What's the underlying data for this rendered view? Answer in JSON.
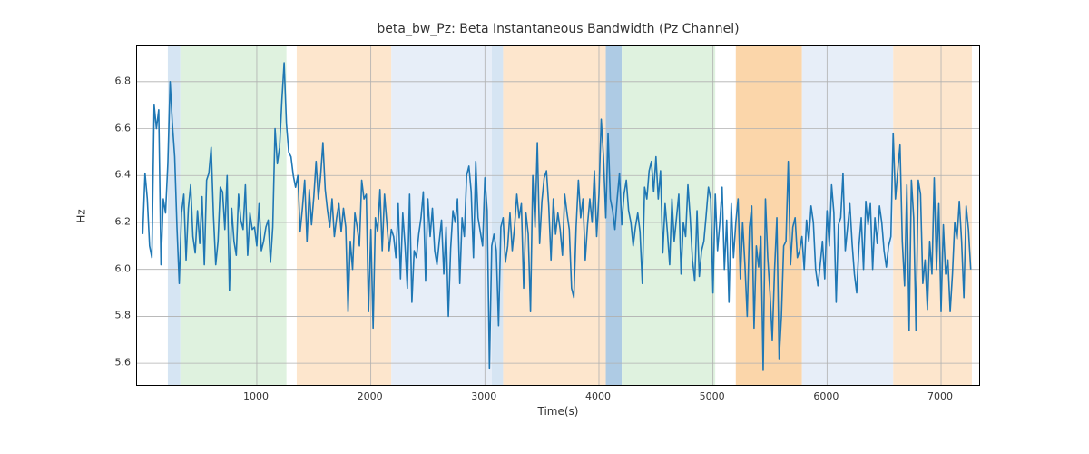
{
  "chart_data": {
    "type": "line",
    "title": "beta_bw_Pz: Beta Instantaneous Bandwidth (Pz Channel)",
    "xlabel": "Time(s)",
    "ylabel": "Hz",
    "xlim": [
      -50,
      7350
    ],
    "ylim": [
      5.5,
      6.95
    ],
    "xticks": [
      1000,
      2000,
      3000,
      4000,
      5000,
      6000,
      7000
    ],
    "yticks": [
      5.6,
      5.8,
      6.0,
      6.2,
      6.4,
      6.6,
      6.8
    ],
    "bands": [
      {
        "x0": 220,
        "x1": 330,
        "color": "#d6e5f3"
      },
      {
        "x0": 330,
        "x1": 1260,
        "color": "#dff2df"
      },
      {
        "x0": 1350,
        "x1": 2180,
        "color": "#fde6cd"
      },
      {
        "x0": 2180,
        "x1": 3060,
        "color": "#e7eef8"
      },
      {
        "x0": 3060,
        "x1": 3160,
        "color": "#d6e5f3"
      },
      {
        "x0": 3160,
        "x1": 4060,
        "color": "#fde6cd"
      },
      {
        "x0": 4060,
        "x1": 4200,
        "color": "#aecbe4"
      },
      {
        "x0": 4200,
        "x1": 5020,
        "color": "#dff2df"
      },
      {
        "x0": 5200,
        "x1": 5780,
        "color": "#fbd6aa"
      },
      {
        "x0": 5780,
        "x1": 6580,
        "color": "#e7eef8"
      },
      {
        "x0": 6580,
        "x1": 7270,
        "color": "#fde6cd"
      }
    ],
    "x": [
      0,
      20,
      40,
      60,
      80,
      100,
      120,
      140,
      160,
      180,
      200,
      220,
      240,
      260,
      280,
      300,
      320,
      340,
      360,
      380,
      400,
      420,
      440,
      460,
      480,
      500,
      520,
      540,
      560,
      580,
      600,
      620,
      640,
      660,
      680,
      700,
      720,
      740,
      760,
      780,
      800,
      820,
      840,
      860,
      880,
      900,
      920,
      940,
      960,
      980,
      1000,
      1020,
      1040,
      1060,
      1080,
      1100,
      1120,
      1140,
      1160,
      1180,
      1200,
      1220,
      1240,
      1260,
      1280,
      1300,
      1320,
      1340,
      1360,
      1380,
      1400,
      1420,
      1440,
      1460,
      1480,
      1500,
      1520,
      1540,
      1560,
      1580,
      1600,
      1620,
      1640,
      1660,
      1680,
      1700,
      1720,
      1740,
      1760,
      1780,
      1800,
      1820,
      1840,
      1860,
      1880,
      1900,
      1920,
      1940,
      1960,
      1980,
      2000,
      2020,
      2040,
      2060,
      2080,
      2100,
      2120,
      2140,
      2160,
      2180,
      2200,
      2220,
      2240,
      2260,
      2280,
      2300,
      2320,
      2340,
      2360,
      2380,
      2400,
      2420,
      2440,
      2460,
      2480,
      2500,
      2520,
      2540,
      2560,
      2580,
      2600,
      2620,
      2640,
      2660,
      2680,
      2700,
      2720,
      2740,
      2760,
      2780,
      2800,
      2820,
      2840,
      2860,
      2880,
      2900,
      2920,
      2940,
      2960,
      2980,
      3000,
      3020,
      3040,
      3060,
      3080,
      3100,
      3120,
      3140,
      3160,
      3180,
      3200,
      3220,
      3240,
      3260,
      3280,
      3300,
      3320,
      3340,
      3360,
      3380,
      3400,
      3420,
      3440,
      3460,
      3480,
      3500,
      3520,
      3540,
      3560,
      3580,
      3600,
      3620,
      3640,
      3660,
      3680,
      3700,
      3720,
      3740,
      3760,
      3780,
      3800,
      3820,
      3840,
      3860,
      3880,
      3900,
      3920,
      3940,
      3960,
      3980,
      4000,
      4020,
      4040,
      4060,
      4080,
      4100,
      4120,
      4140,
      4160,
      4180,
      4200,
      4220,
      4240,
      4260,
      4280,
      4300,
      4320,
      4340,
      4360,
      4380,
      4400,
      4420,
      4440,
      4460,
      4480,
      4500,
      4520,
      4540,
      4560,
      4580,
      4600,
      4620,
      4640,
      4660,
      4680,
      4700,
      4720,
      4740,
      4760,
      4780,
      4800,
      4820,
      4840,
      4860,
      4880,
      4900,
      4920,
      4940,
      4960,
      4980,
      5000,
      5020,
      5040,
      5060,
      5080,
      5100,
      5120,
      5140,
      5160,
      5180,
      5200,
      5220,
      5240,
      5260,
      5280,
      5300,
      5320,
      5340,
      5360,
      5380,
      5400,
      5420,
      5440,
      5460,
      5480,
      5500,
      5520,
      5540,
      5560,
      5580,
      5600,
      5620,
      5640,
      5660,
      5680,
      5700,
      5720,
      5740,
      5760,
      5780,
      5800,
      5820,
      5840,
      5860,
      5880,
      5900,
      5920,
      5940,
      5960,
      5980,
      6000,
      6020,
      6040,
      6060,
      6080,
      6100,
      6120,
      6140,
      6160,
      6180,
      6200,
      6220,
      6240,
      6260,
      6280,
      6300,
      6320,
      6340,
      6360,
      6380,
      6400,
      6420,
      6440,
      6460,
      6480,
      6500,
      6520,
      6540,
      6560,
      6580,
      6600,
      6620,
      6640,
      6660,
      6680,
      6700,
      6720,
      6740,
      6760,
      6780,
      6800,
      6820,
      6840,
      6860,
      6880,
      6900,
      6920,
      6940,
      6960,
      6980,
      7000,
      7020,
      7040,
      7060,
      7080,
      7100,
      7120,
      7140,
      7160,
      7180,
      7200,
      7220,
      7240,
      7260
    ],
    "y": [
      6.15,
      6.41,
      6.3,
      6.1,
      6.05,
      6.7,
      6.6,
      6.68,
      6.02,
      6.3,
      6.24,
      6.45,
      6.8,
      6.62,
      6.48,
      6.18,
      5.94,
      6.24,
      6.32,
      6.04,
      6.26,
      6.36,
      6.14,
      6.07,
      6.25,
      6.11,
      6.31,
      6.02,
      6.38,
      6.41,
      6.52,
      6.23,
      6.02,
      6.12,
      6.35,
      6.33,
      6.17,
      6.4,
      5.91,
      6.26,
      6.12,
      6.06,
      6.32,
      6.21,
      6.17,
      6.36,
      6.06,
      6.24,
      6.17,
      6.18,
      6.1,
      6.28,
      6.08,
      6.12,
      6.18,
      6.21,
      6.03,
      6.18,
      6.6,
      6.45,
      6.52,
      6.72,
      6.88,
      6.62,
      6.5,
      6.48,
      6.4,
      6.35,
      6.4,
      6.16,
      6.26,
      6.38,
      6.12,
      6.34,
      6.19,
      6.31,
      6.46,
      6.3,
      6.4,
      6.54,
      6.34,
      6.25,
      6.18,
      6.3,
      6.14,
      6.22,
      6.28,
      6.16,
      6.26,
      6.18,
      5.82,
      6.12,
      6.0,
      6.24,
      6.18,
      6.1,
      6.38,
      6.3,
      6.32,
      5.82,
      6.17,
      5.75,
      6.22,
      6.16,
      6.34,
      6.08,
      6.32,
      6.2,
      6.08,
      6.17,
      6.14,
      6.05,
      6.28,
      5.96,
      6.24,
      6.1,
      5.92,
      6.32,
      5.86,
      6.08,
      6.05,
      6.15,
      6.22,
      6.33,
      5.95,
      6.3,
      6.14,
      6.26,
      6.08,
      6.02,
      6.12,
      6.21,
      5.98,
      6.18,
      5.8,
      6.09,
      6.25,
      6.2,
      6.3,
      5.94,
      6.22,
      6.14,
      6.4,
      6.44,
      6.33,
      6.05,
      6.46,
      6.22,
      6.16,
      6.1,
      6.39,
      6.25,
      5.58,
      6.1,
      6.15,
      6.08,
      5.76,
      6.18,
      6.22,
      6.03,
      6.1,
      6.24,
      6.08,
      6.18,
      6.32,
      6.22,
      6.28,
      5.92,
      6.24,
      6.15,
      5.82,
      6.4,
      6.18,
      6.54,
      6.11,
      6.29,
      6.39,
      6.42,
      6.27,
      6.04,
      6.3,
      6.15,
      6.24,
      6.17,
      6.06,
      6.32,
      6.24,
      6.17,
      5.92,
      5.88,
      6.18,
      6.38,
      6.22,
      6.3,
      6.04,
      6.19,
      6.3,
      6.2,
      6.42,
      6.14,
      6.32,
      6.64,
      6.48,
      6.22,
      6.58,
      6.3,
      6.25,
      6.17,
      6.3,
      6.41,
      6.19,
      6.32,
      6.38,
      6.25,
      6.2,
      6.1,
      6.18,
      6.24,
      6.16,
      5.94,
      6.35,
      6.3,
      6.42,
      6.46,
      6.33,
      6.48,
      6.3,
      6.42,
      6.07,
      6.28,
      6.16,
      6.02,
      6.3,
      6.12,
      6.22,
      6.32,
      5.98,
      6.2,
      6.14,
      6.36,
      6.22,
      6.04,
      5.95,
      6.25,
      5.97,
      6.08,
      6.12,
      6.23,
      6.35,
      6.3,
      5.9,
      6.32,
      6.08,
      6.2,
      6.35,
      6.0,
      6.21,
      5.86,
      6.28,
      6.05,
      6.2,
      6.3,
      5.96,
      6.2,
      6.02,
      5.8,
      6.18,
      6.27,
      5.75,
      6.1,
      6.01,
      6.14,
      5.57,
      6.3,
      6.05,
      5.9,
      5.7,
      6.0,
      6.22,
      5.62,
      5.8,
      6.1,
      6.12,
      6.46,
      6.02,
      6.18,
      6.22,
      6.05,
      6.08,
      6.14,
      6.0,
      6.21,
      6.12,
      6.27,
      6.2,
      6.0,
      5.93,
      6.02,
      6.12,
      5.96,
      6.25,
      6.1,
      6.36,
      6.24,
      5.86,
      6.19,
      6.22,
      6.41,
      6.08,
      6.18,
      6.28,
      6.11,
      5.98,
      5.9,
      6.1,
      6.22,
      6.0,
      6.29,
      6.19,
      6.28,
      6.0,
      6.22,
      6.11,
      6.27,
      6.2,
      6.08,
      6.01,
      6.1,
      6.14,
      6.58,
      6.3,
      6.42,
      6.53,
      6.12,
      5.93,
      6.36,
      5.74,
      6.38,
      6.22,
      5.74,
      6.38,
      6.32,
      5.94,
      6.04,
      5.83,
      6.12,
      5.98,
      6.39,
      6.0,
      6.28,
      5.82,
      6.19,
      5.98,
      6.04,
      5.82,
      5.98,
      6.2,
      6.13,
      6.29,
      6.12,
      5.88,
      6.27,
      6.17,
      6.0
    ]
  }
}
